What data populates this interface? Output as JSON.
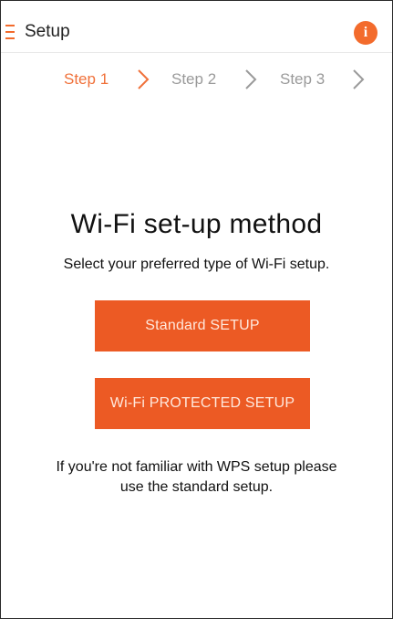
{
  "header": {
    "title": "Setup",
    "menu_icon": "hamburger-menu-icon",
    "info_icon": "info-icon",
    "info_glyph": "i",
    "accent_color": "#f36b2c"
  },
  "steps": {
    "items": [
      {
        "label": "Step 1",
        "active": true
      },
      {
        "label": "Step 2",
        "active": false
      },
      {
        "label": "Step 3",
        "active": false
      }
    ],
    "active_color": "#f0713a",
    "inactive_color": "#9a9a9a"
  },
  "main": {
    "heading": "Wi-Fi set-up method",
    "subheading": "Select your preferred type of Wi-Fi setup.",
    "buttons": {
      "standard_label": "Standard SETUP",
      "wps_label": "Wi-Fi PROTECTED SETUP",
      "color": "#ec5a24"
    },
    "note": "If you're not familiar with WPS setup please use the standard setup."
  }
}
